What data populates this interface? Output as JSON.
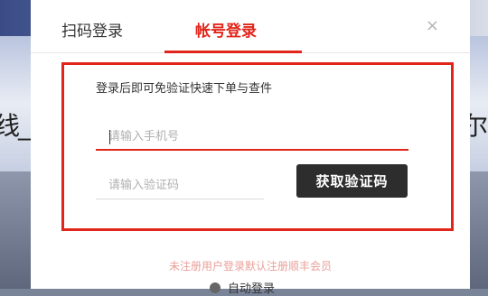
{
  "background": {
    "left_glyph": "线_",
    "right_glyph": "尔"
  },
  "tabs": {
    "qr_login": "扫码登录",
    "account_login": "帐号登录"
  },
  "close_symbol": "×",
  "form": {
    "hint": "登录后即可免验证快速下单与查件",
    "phone_placeholder": "请输入手机号",
    "code_placeholder": "请输入验证码",
    "get_code_label": "获取验证码"
  },
  "notice": "未注册用户登录默认注册顺丰会员",
  "auto_login_label": "自动登录",
  "colors": {
    "accent": "#e1251b",
    "button_dark": "#2d2d2d",
    "notice": "#e8a09a"
  }
}
